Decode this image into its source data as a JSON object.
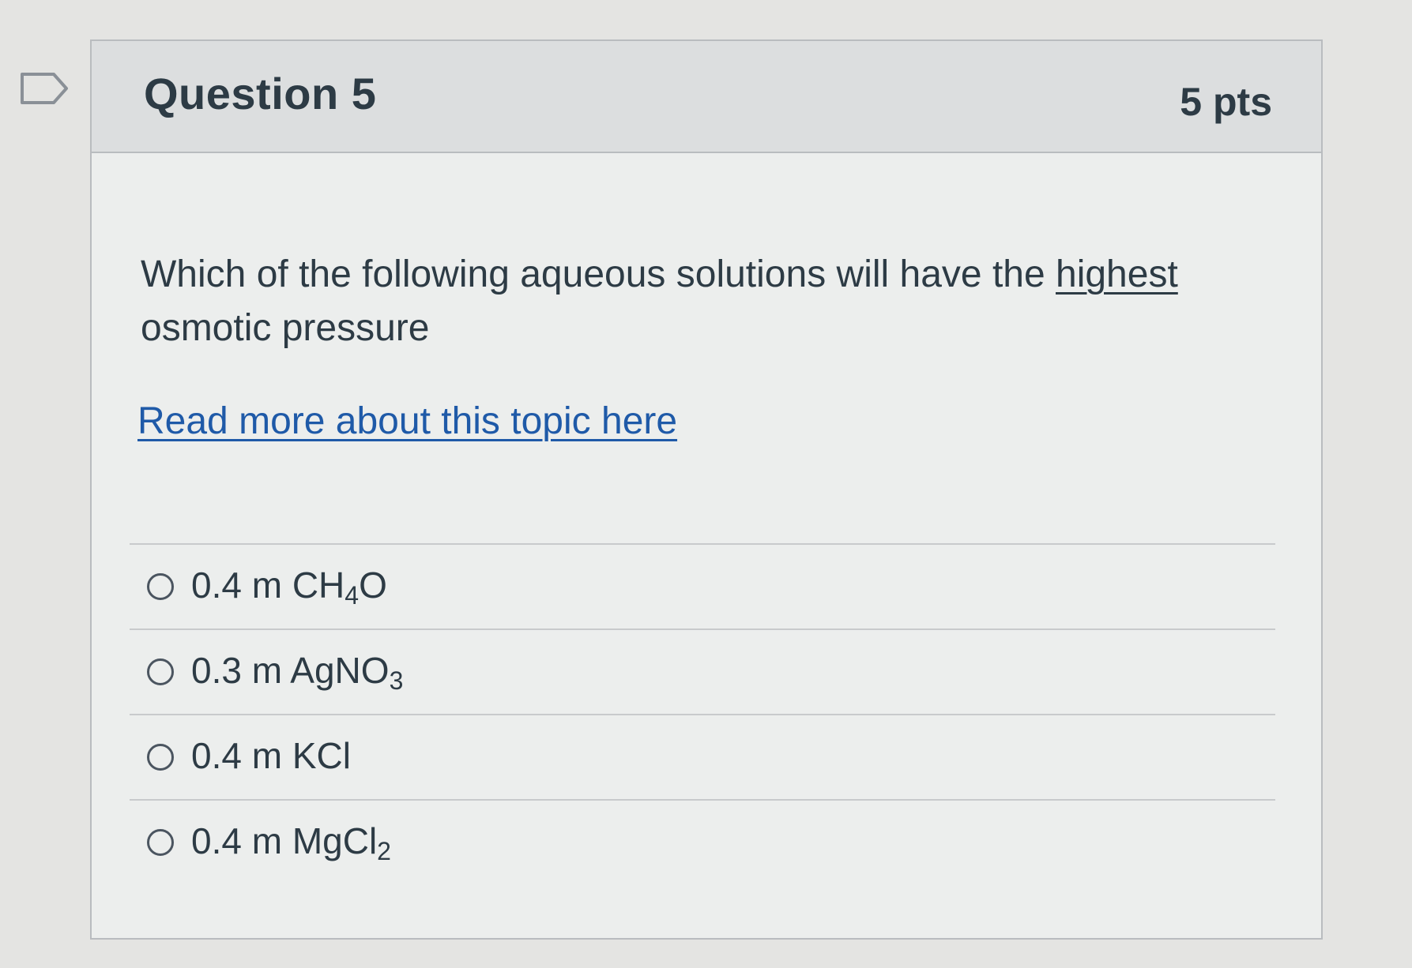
{
  "question": {
    "title": "Question 5",
    "points": "5 pts",
    "text_before_emphasis": "Which of the following aqueous solutions will have the ",
    "text_emphasis": "highest",
    "text_after_emphasis": " osmotic pressure",
    "link_text": "Read more about this topic here"
  },
  "answers": [
    {
      "main": "0.4 m CH",
      "sub": "4",
      "tail": "O",
      "selected": false
    },
    {
      "main": "0.3 m AgNO",
      "sub": "3",
      "tail": "",
      "selected": false
    },
    {
      "main": "0.4 m KCl",
      "sub": "",
      "tail": "",
      "selected": false
    },
    {
      "main": "0.4 m MgCl",
      "sub": "2",
      "tail": "",
      "selected": false
    }
  ],
  "icons": {
    "flag": "flag-question-icon"
  },
  "colors": {
    "link": "#1f5aa8",
    "text": "#2d3b45",
    "header_bg": "#dcdedf"
  }
}
